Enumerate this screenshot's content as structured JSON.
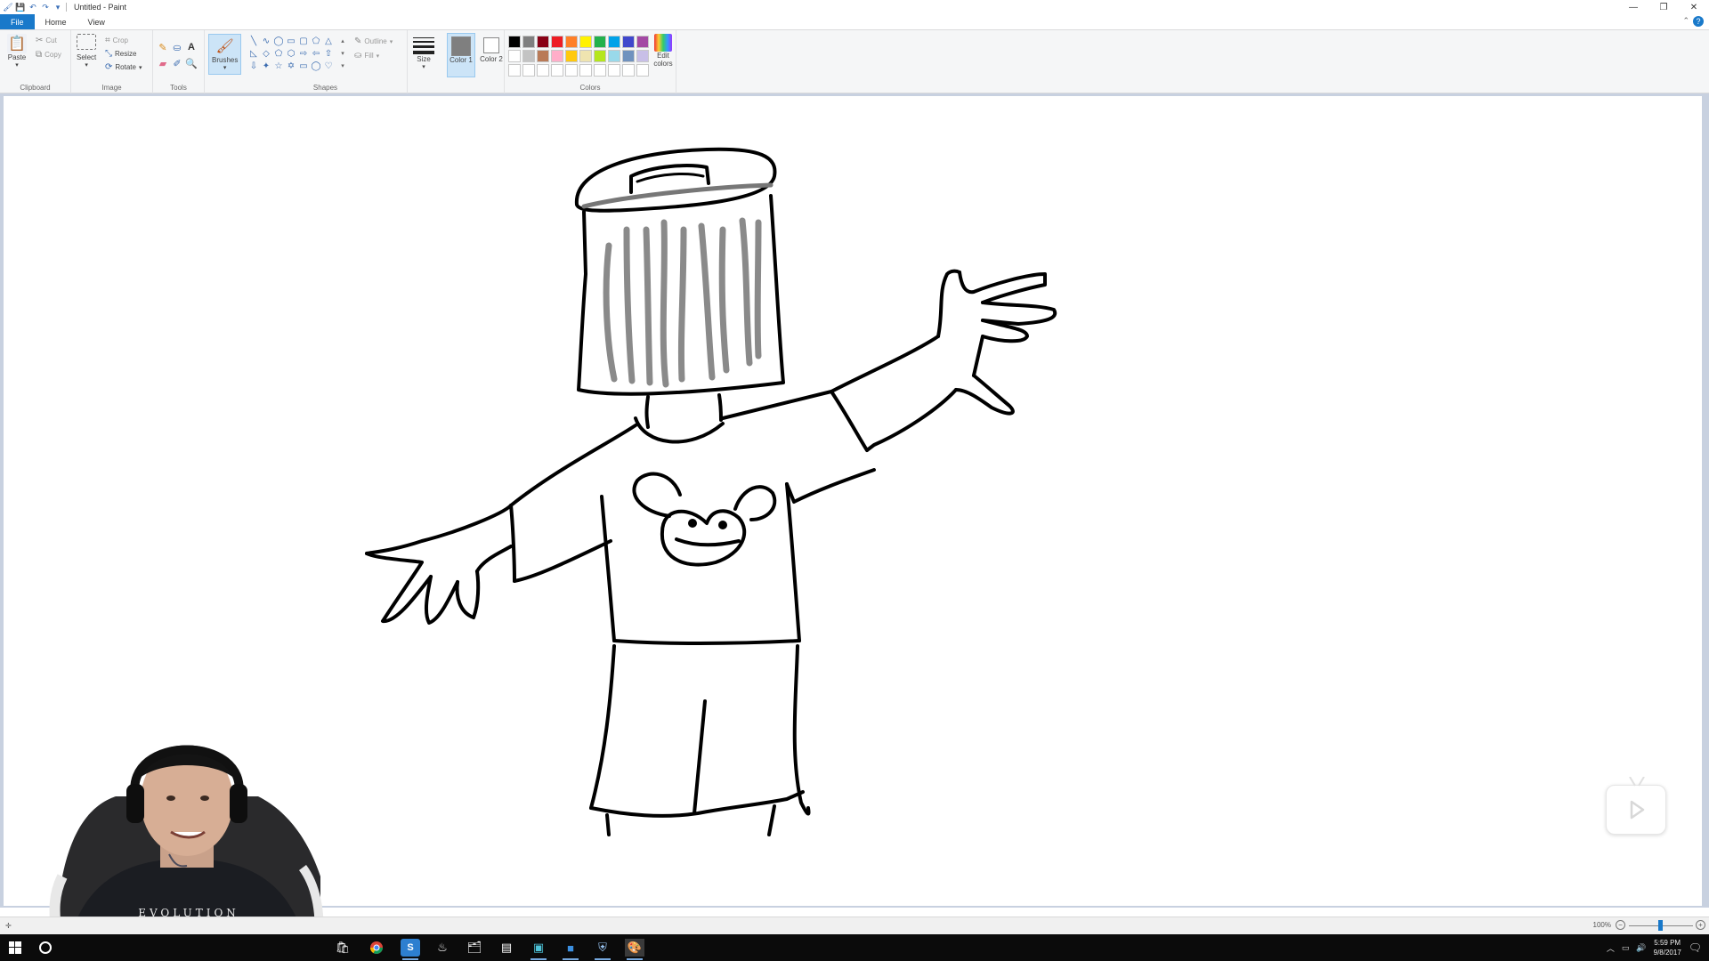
{
  "window": {
    "title": "Untitled - Paint"
  },
  "tabs": [
    {
      "label": "File"
    },
    {
      "label": "Home"
    },
    {
      "label": "View"
    }
  ],
  "ribbon": {
    "clipboard": {
      "label": "Clipboard",
      "paste": "Paste",
      "cut": "Cut",
      "copy": "Copy"
    },
    "image": {
      "label": "Image",
      "select": "Select",
      "crop": "Crop",
      "resize": "Resize",
      "rotate": "Rotate"
    },
    "tools": {
      "label": "Tools"
    },
    "brushes": {
      "label": "Brushes"
    },
    "shapes": {
      "label": "Shapes",
      "outline": "Outline",
      "fill": "Fill"
    },
    "size": {
      "label": "Size"
    },
    "color1": {
      "label": "Color 1",
      "value": "#7f7f7f"
    },
    "color2": {
      "label": "Color 2",
      "value": "#ffffff"
    },
    "colors": {
      "label": "Colors",
      "edit": "Edit colors",
      "row1": [
        "#000000",
        "#7f7f7f",
        "#880015",
        "#ed1c24",
        "#ff7f27",
        "#fff200",
        "#22b14c",
        "#00a2e8",
        "#3f48cc",
        "#a349a4"
      ],
      "row2": [
        "#ffffff",
        "#c3c3c3",
        "#b97a57",
        "#ffaec9",
        "#ffc90e",
        "#efe4b0",
        "#b5e61d",
        "#99d9ea",
        "#7092be",
        "#c8bfe7"
      ]
    }
  },
  "status": {
    "zoom": "100%"
  },
  "taskbar": {
    "time": "5:59 PM",
    "date": "9/8/2017"
  },
  "webcam": {
    "shirt_text": "EVOLUTION"
  }
}
